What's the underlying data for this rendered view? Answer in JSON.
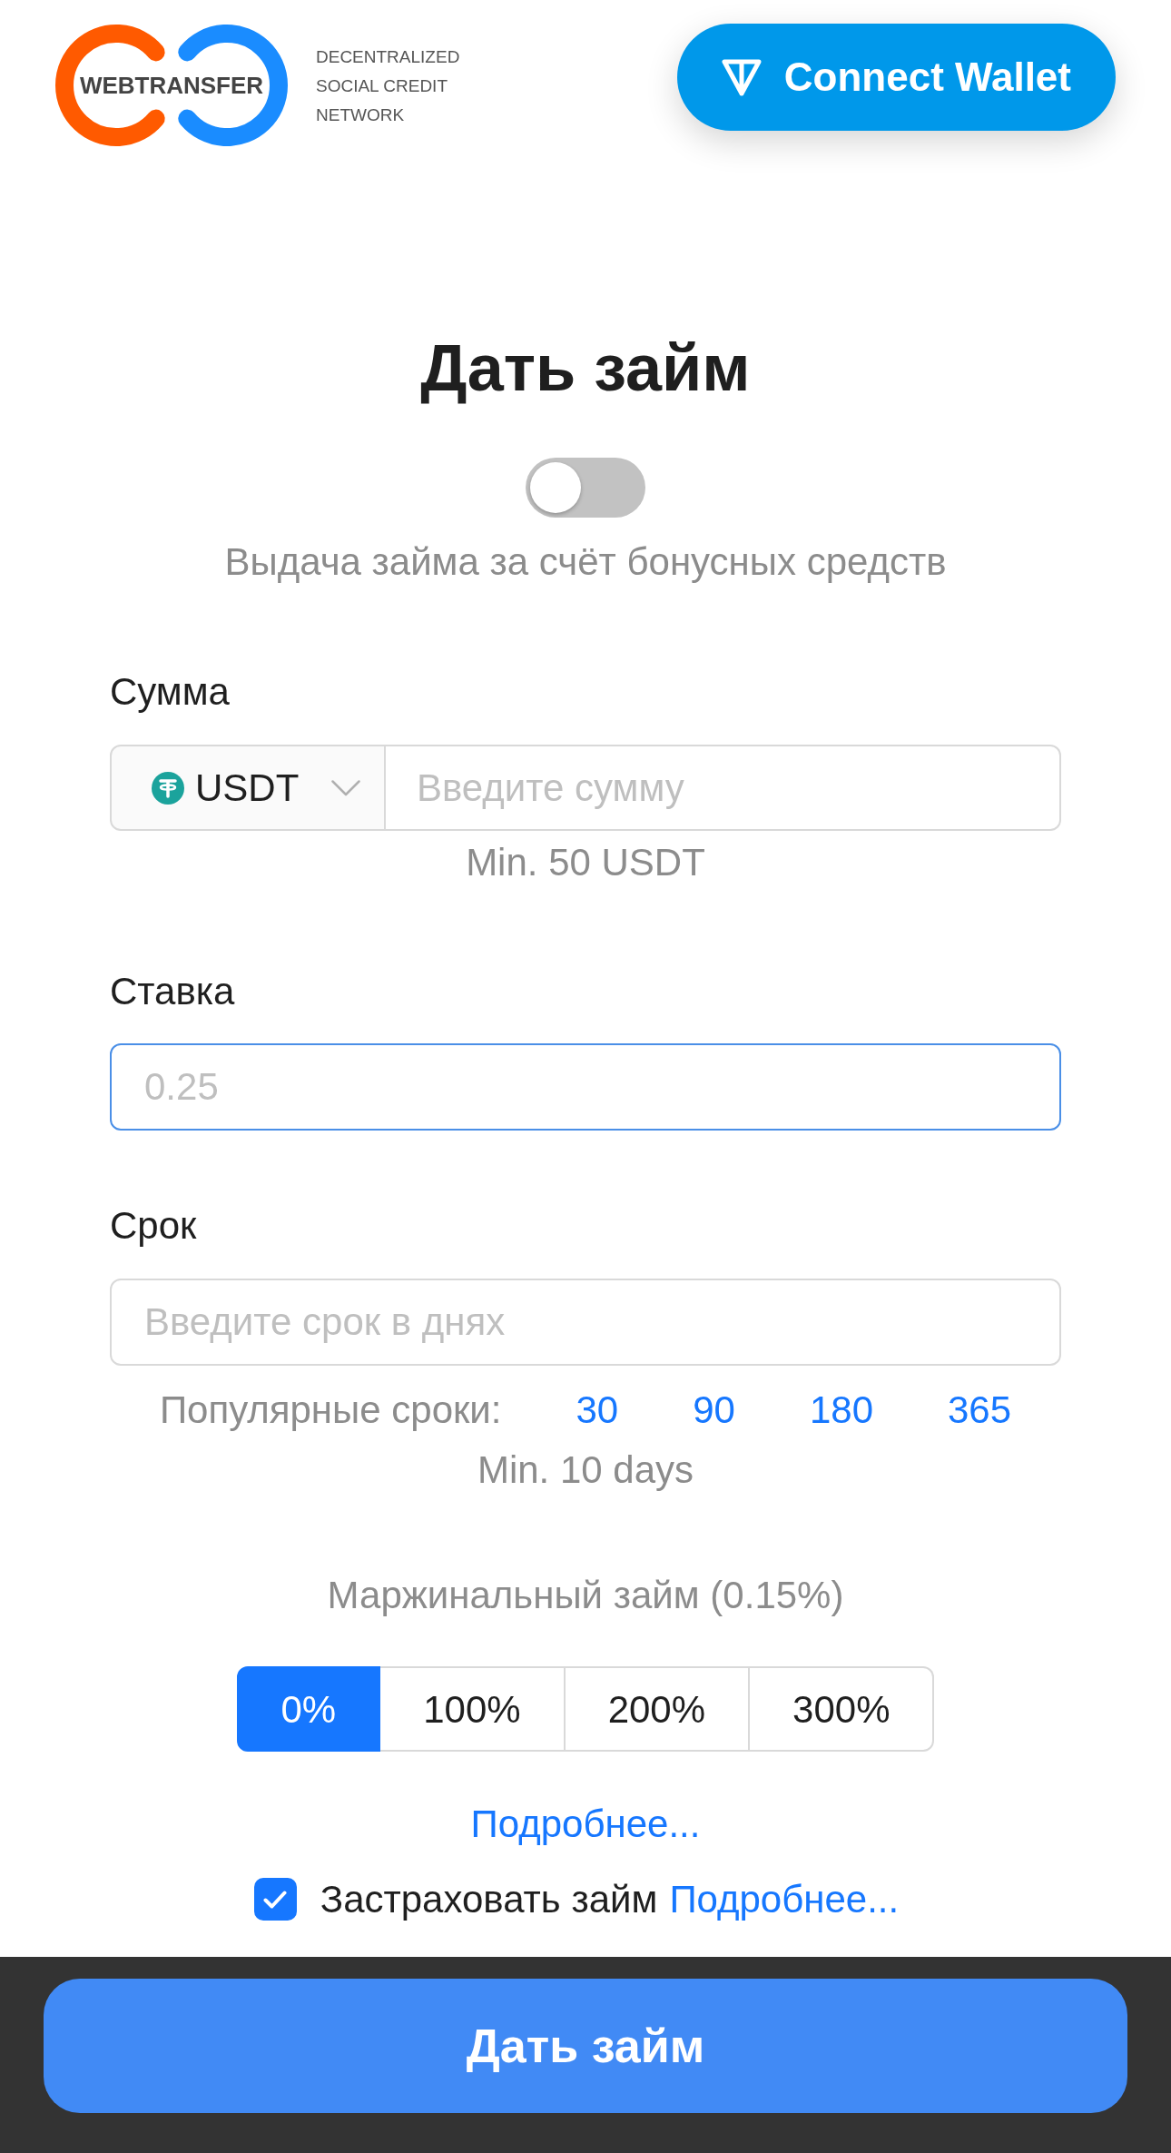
{
  "header": {
    "logo_text": "WEBTRANSFER",
    "tagline": [
      "DECENTRALIZED",
      "SOCIAL CREDIT",
      "NETWORK"
    ],
    "connect_button": "Connect Wallet"
  },
  "title": "Дать займ",
  "bonus_toggle": {
    "on": false,
    "label": "Выдача займа за счёт бонусных средств"
  },
  "amount": {
    "label": "Сумма",
    "currency": "USDT",
    "placeholder": "Введите сумму",
    "focused": false,
    "hint": "Min. 50 USDT"
  },
  "rate": {
    "label": "Ставка",
    "placeholder": "0.25",
    "focused": true
  },
  "term": {
    "label": "Срок",
    "placeholder": "Введите срок в днях",
    "focused": false,
    "popular_label": "Популярные сроки:",
    "popular": [
      "30",
      "90",
      "180",
      "365"
    ],
    "hint": "Min. 10 days"
  },
  "margin": {
    "label": "Маржинальный займ (0.15%)",
    "options": [
      {
        "label": "0%",
        "selected": true
      },
      {
        "label": "100%",
        "selected": false
      },
      {
        "label": "200%",
        "selected": false
      },
      {
        "label": "300%",
        "selected": false
      }
    ],
    "more_link": "Подробнее..."
  },
  "insurance": {
    "checked": true,
    "label": "Застраховать займ",
    "more_link": "Подробнее..."
  },
  "submit_button": "Дать займ"
}
